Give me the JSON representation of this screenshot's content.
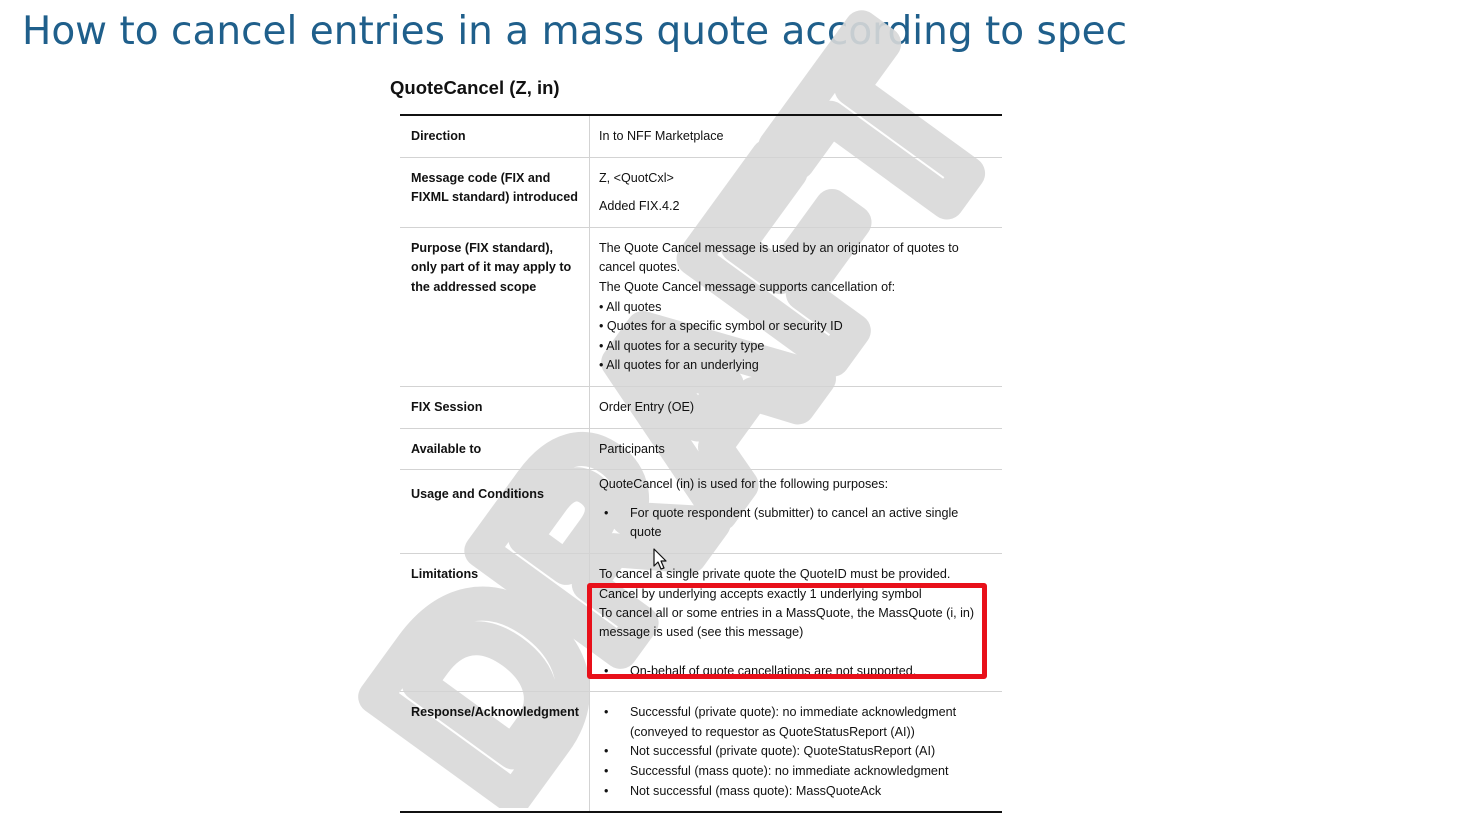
{
  "slide": {
    "title": "How to cancel entries in a mass quote according to spec"
  },
  "doc": {
    "heading": "QuoteCancel (Z, in)",
    "watermark": "DRAFT",
    "rows": {
      "direction": {
        "label": "Direction",
        "value": "In to NFF Marketplace"
      },
      "message_code": {
        "label": "Message code (FIX and FIXML standard) introduced",
        "line1": "Z, <QuotCxl>",
        "line2": "Added  FIX.4.2"
      },
      "purpose": {
        "label": "Purpose (FIX standard), only part of it may apply to the addressed scope",
        "line1": "The Quote Cancel message is used by an originator of quotes to cancel quotes.",
        "line2": "The Quote Cancel message supports cancellation of:",
        "bullets": [
          "• All quotes",
          "• Quotes for a specific symbol or security ID",
          "• All quotes for a security type",
          "• All quotes for an underlying"
        ]
      },
      "fix_session": {
        "label": "FIX Session",
        "value": "Order Entry (OE)"
      },
      "available_to": {
        "label": "Available to",
        "value": "Participants"
      },
      "usage": {
        "label": "Usage and Conditions",
        "intro": "QuoteCancel (in) is used for the following purposes:",
        "bullets": [
          "For quote respondent (submitter) to cancel an active single quote"
        ]
      },
      "limitations": {
        "label": "Limitations",
        "line1": "To cancel a single private quote the QuoteID must be provided.",
        "line2": "Cancel by underlying accepts exactly 1 underlying symbol",
        "line3": "To cancel all or some entries in a MassQuote, the MassQuote (i, in) message is used (see this message)",
        "bullets": [
          "On-behalf of quote cancellations are not supported."
        ]
      },
      "response": {
        "label": "Response/Acknowledgment",
        "bullets": [
          "Successful (private quote): no immediate acknowledgment (conveyed to requestor as QuoteStatusReport (AI))",
          "Not successful (private quote): QuoteStatusReport (AI)",
          "Successful (mass quote): no immediate acknowledgment",
          "Not successful (mass quote): MassQuoteAck"
        ]
      }
    }
  },
  "colors": {
    "title": "#1f5f8b",
    "highlight": "#e8101a",
    "watermark": "#d9d9d9"
  },
  "icons": {
    "cursor": "mouse-pointer-icon"
  }
}
